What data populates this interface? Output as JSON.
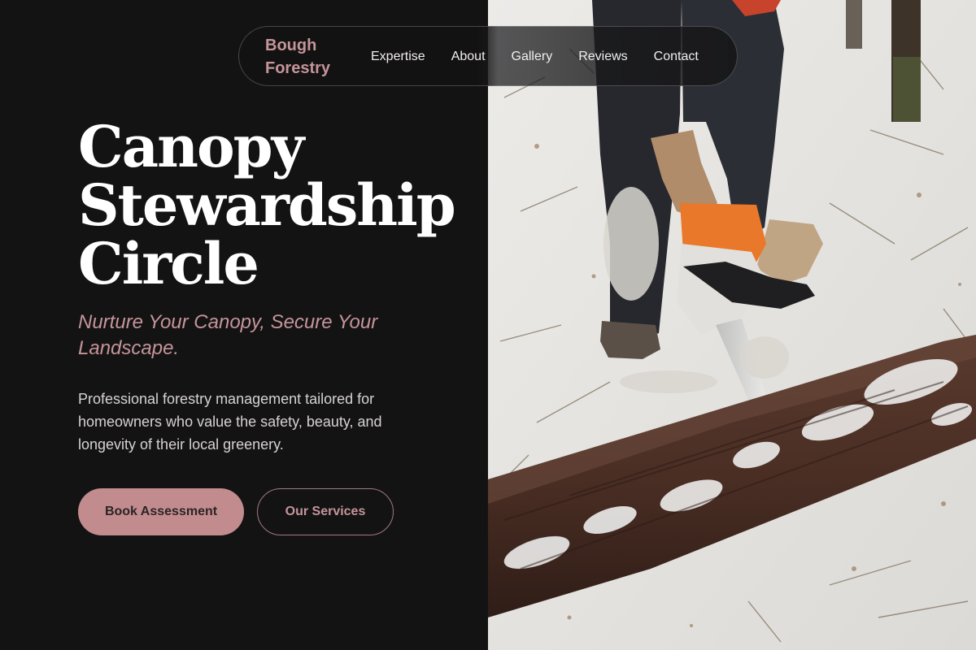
{
  "brand": {
    "name": "Bough Forestry"
  },
  "nav": {
    "items": [
      {
        "label": "Expertise"
      },
      {
        "label": "About"
      },
      {
        "label": "Gallery"
      },
      {
        "label": "Reviews"
      },
      {
        "label": "Contact"
      }
    ]
  },
  "hero": {
    "title_lines": [
      "Canopy",
      "Stewardship",
      "Circle"
    ],
    "tagline": "Nurture Your Canopy, Secure Your Landscape.",
    "description": "Professional forestry management tailored for homeowners who value the safety, beauty, and longevity of their local greenery.",
    "primary_cta": "Book Assessment",
    "secondary_cta": "Our Services"
  },
  "colors": {
    "background": "#141314",
    "accent": "#c28c8f",
    "accent_text": "#c4959a",
    "heading": "#ffffff",
    "body_text": "#d6d2d3"
  },
  "photo": {
    "subject": "chainsaw-cutting-log-in-snow"
  }
}
